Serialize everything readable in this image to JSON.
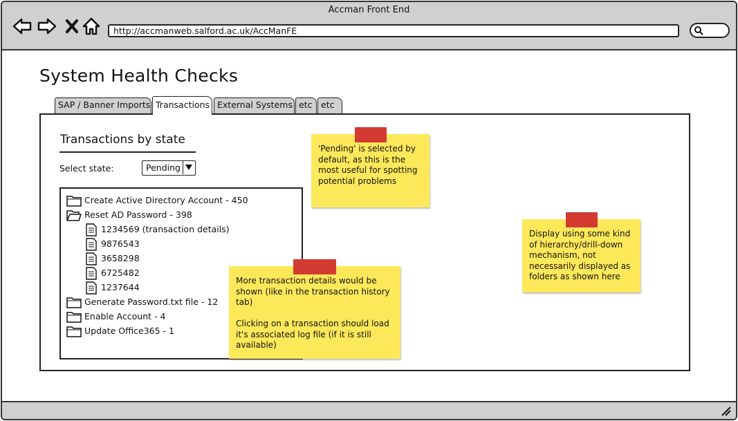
{
  "window": {
    "title": "Accman Front End"
  },
  "browser": {
    "url": "http://accmanweb.salford.ac.uk/AccManFE",
    "icons": [
      "back-arrow-icon",
      "forward-arrow-icon",
      "close-x-icon",
      "home-icon",
      "search-icon"
    ]
  },
  "page": {
    "title": "System Health Checks",
    "tabs": [
      {
        "label": "SAP / Banner Imports",
        "active": false
      },
      {
        "label": "Transactions",
        "active": true
      },
      {
        "label": "External Systems",
        "active": false
      },
      {
        "label": "etc",
        "active": false
      },
      {
        "label": "etc",
        "active": false
      }
    ]
  },
  "transactions": {
    "section_title": "Transactions by state",
    "select_label": "Select state:",
    "selected_state": "Pending",
    "tree": [
      {
        "label": "Create Active Directory Account - 450",
        "type": "folder",
        "open": false
      },
      {
        "label": "Reset AD Password - 398",
        "type": "folder",
        "open": true
      },
      {
        "label": "1234569 (transaction details)",
        "type": "doc"
      },
      {
        "label": "9876543",
        "type": "doc"
      },
      {
        "label": "3658298",
        "type": "doc"
      },
      {
        "label": "6725482",
        "type": "doc"
      },
      {
        "label": "1237644",
        "type": "doc"
      },
      {
        "label": "Generate Password.txt file - 12",
        "type": "folder",
        "open": false
      },
      {
        "label": "Enable Account - 4",
        "type": "folder",
        "open": false
      },
      {
        "label": "Update Office365 - 1",
        "type": "folder",
        "open": false
      }
    ]
  },
  "notes": [
    {
      "text": "'Pending' is selected by default, as this is the most useful for spotting potential problems"
    },
    {
      "text": "Display using some kind of hierarchy/drill-down mechanism, not necessarily displayed as folders as shown here"
    },
    {
      "text": "More transaction details would be shown (like in the transaction history tab)\n\nClicking on a transaction should load it's associated log file (if it is still available)"
    }
  ],
  "colors": {
    "chrome": "#d0d0d0",
    "note": "#fde85a",
    "tape": "#d33a32"
  }
}
